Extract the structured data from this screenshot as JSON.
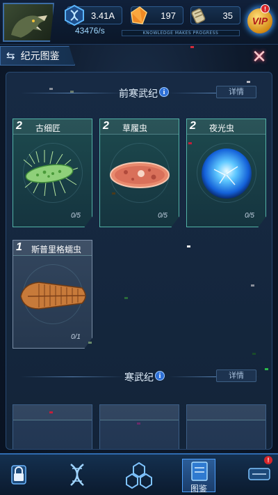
{
  "hud": {
    "gene_value": "3.41A",
    "gene_rate": "43476/s",
    "crystal_value": "197",
    "fossil_value": "35",
    "progress_strip_text": "KNOWLEDGE MAKES PROGRESS",
    "vip_label": "VIP",
    "vip_badge": "!"
  },
  "titlebar": {
    "title": "纪元图鉴",
    "close_symbol": "✕"
  },
  "eras": [
    {
      "name": "前寒武纪",
      "info": "i",
      "detail_label": "详情",
      "cards": [
        {
          "level": "2",
          "name": "古细匠",
          "count": "0/5",
          "rarity": "green",
          "art": "bacteria-art"
        },
        {
          "level": "2",
          "name": "草履虫",
          "count": "0/5",
          "rarity": "green",
          "art": "paramecium-art"
        },
        {
          "level": "2",
          "name": "夜光虫",
          "count": "0/5",
          "rarity": "green",
          "art": "noctiluca-art"
        },
        {
          "level": "1",
          "name": "斯普里格蠕虫",
          "count": "0/1",
          "rarity": "gray",
          "art": "spriggina-art"
        }
      ]
    },
    {
      "name": "寒武纪",
      "info": "i",
      "detail_label": "详情",
      "cards": [
        {
          "level": "",
          "name": "",
          "count": "",
          "rarity": "empty"
        },
        {
          "level": "",
          "name": "",
          "count": "",
          "rarity": "empty"
        },
        {
          "level": "",
          "name": "",
          "count": "",
          "rarity": "empty"
        }
      ]
    }
  ],
  "nav": {
    "items": [
      {
        "icon": "lock-icon",
        "label": "",
        "active": false
      },
      {
        "icon": "dna-icon",
        "label": "",
        "active": false
      },
      {
        "icon": "hexagon-cluster-icon",
        "label": "",
        "active": false
      },
      {
        "icon": "codex-icon",
        "label": "图鉴",
        "active": true
      },
      {
        "icon": "chat-icon",
        "label": "",
        "active": false,
        "badge": "!"
      }
    ]
  },
  "colors": {
    "accent": "#2f6bb0",
    "green_frame": "#53b3a8",
    "gray_frame": "#7a8ea6",
    "badge_red": "#d8262a"
  }
}
